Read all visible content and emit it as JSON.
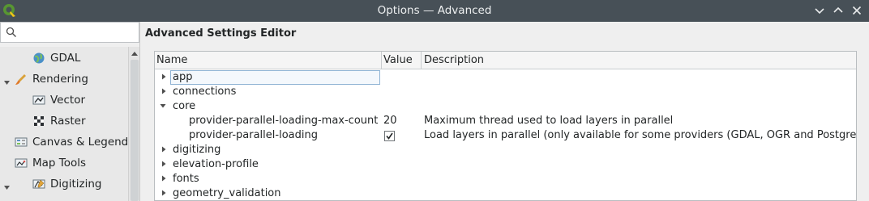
{
  "window": {
    "title": "Options — Advanced",
    "controls": {
      "minimize": "chevron-down-icon",
      "maximize": "chevron-up-icon",
      "close": "close-icon"
    }
  },
  "search": {
    "placeholder": "",
    "value": ""
  },
  "nav": {
    "items": [
      {
        "label": "GDAL",
        "icon": "gdal-globe-icon",
        "level": 2
      },
      {
        "label": "Rendering",
        "icon": "rendering-brush-icon",
        "level": 1,
        "expanded": true
      },
      {
        "label": "Vector",
        "icon": "vector-render-icon",
        "level": 2
      },
      {
        "label": "Raster",
        "icon": "raster-render-icon",
        "level": 2
      },
      {
        "label": "Canvas & Legend",
        "icon": "canvas-legend-icon",
        "level": 1
      },
      {
        "label": "Map Tools",
        "icon": "map-tools-icon",
        "level": 1,
        "expanded": true
      },
      {
        "label": "Digitizing",
        "icon": "digitizing-icon",
        "level": 2
      }
    ]
  },
  "editor": {
    "title": "Advanced Settings Editor",
    "columns": {
      "name": "Name",
      "value": "Value",
      "description": "Description"
    },
    "rows": [
      {
        "name": "app",
        "expanded": false,
        "level": 0,
        "selected": true
      },
      {
        "name": "connections",
        "expanded": false,
        "level": 0
      },
      {
        "name": "core",
        "expanded": true,
        "level": 0
      },
      {
        "name": "provider-parallel-loading-max-count",
        "level": 1,
        "value": "20",
        "description": "Maximum thread used to load layers in parallel"
      },
      {
        "name": "provider-parallel-loading",
        "level": 1,
        "checked": true,
        "description": "Load layers in parallel (only available for some providers (GDAL, OGR and PostgreSQL)"
      },
      {
        "name": "digitizing",
        "expanded": false,
        "level": 0
      },
      {
        "name": "elevation-profile",
        "expanded": false,
        "level": 0
      },
      {
        "name": "fonts",
        "expanded": false,
        "level": 0
      },
      {
        "name": "geometry_validation",
        "expanded": false,
        "level": 0
      }
    ]
  },
  "colors": {
    "titlebar": "#475057",
    "qgis_green": "#589632",
    "qgis_yellow": "#ee7913"
  }
}
